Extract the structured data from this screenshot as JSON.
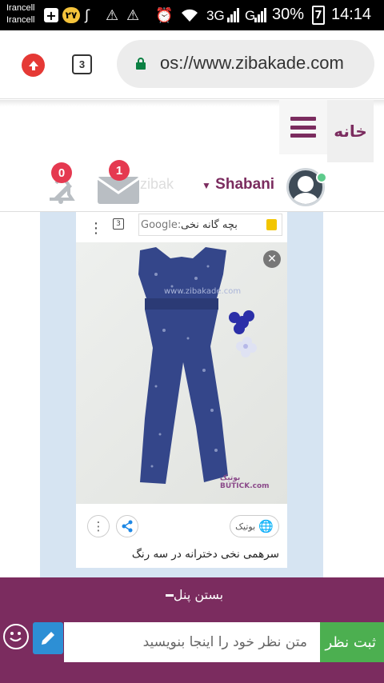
{
  "status_bar": {
    "carrier_1": "Irancell",
    "carrier_2": "Irancell",
    "notification_count": "۲۷",
    "network_1": "3G",
    "network_2": "G",
    "battery": "30%",
    "battery_level": "7",
    "time": "14:14"
  },
  "browser": {
    "tab_count": "3",
    "url": "os://www.zibakade.com"
  },
  "site_header": {
    "home_label": "خانه",
    "username": "Shabani",
    "watermark": "zibak",
    "bell_badge": "0",
    "mail_badge": "1"
  },
  "post": {
    "mini_tab_count": "3",
    "mini_search_prefix": "Google:",
    "mini_search_query": "بچه گانه نخی",
    "photo_watermark": "www.zibakade.com",
    "photo_logo": "بوتیک BUTICK.com",
    "source_label": "بوتیک",
    "caption": "سرهمی نخی دخترانه در سه رنگ"
  },
  "panel": {
    "close_label": "بستن پنل",
    "comment_placeholder": "متن نظر خود را اینجا بنویسید",
    "submit_label": "ثبت نظر"
  },
  "colors": {
    "brand": "#7b2c5f",
    "submit": "#4caf50",
    "badge": "#e53950",
    "content_bg": "#d6e4f2"
  }
}
